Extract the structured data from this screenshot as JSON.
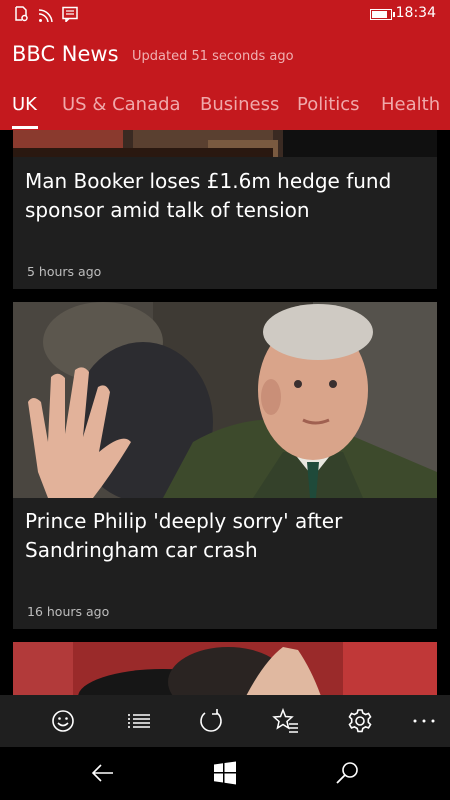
{
  "status_bar": {
    "time": "18:34",
    "battery_level": 0.85
  },
  "header": {
    "title": "BBC News",
    "updated": "Updated 51 seconds ago",
    "tabs": [
      "UK",
      "US & Canada",
      "Business",
      "Politics",
      "Health"
    ],
    "active_tab": "UK"
  },
  "feed": {
    "cards": [
      {
        "title": "Man Booker loses £1.6m hedge fund sponsor amid talk of tension",
        "time": "5 hours ago"
      },
      {
        "title": "Prince Philip 'deeply sorry' after Sandringham car crash",
        "time": "16 hours ago"
      }
    ]
  },
  "app_bar": {
    "icons": [
      "smiley-icon",
      "list-icon",
      "refresh-icon",
      "favorites-icon",
      "settings-icon",
      "more-icon"
    ]
  },
  "nav_bar": {
    "icons": [
      "back-icon",
      "windows-icon",
      "search-icon"
    ]
  },
  "colors": {
    "brand": "#c4191e",
    "card": "#1f1f1f",
    "time_text": "#bdbdbd"
  }
}
